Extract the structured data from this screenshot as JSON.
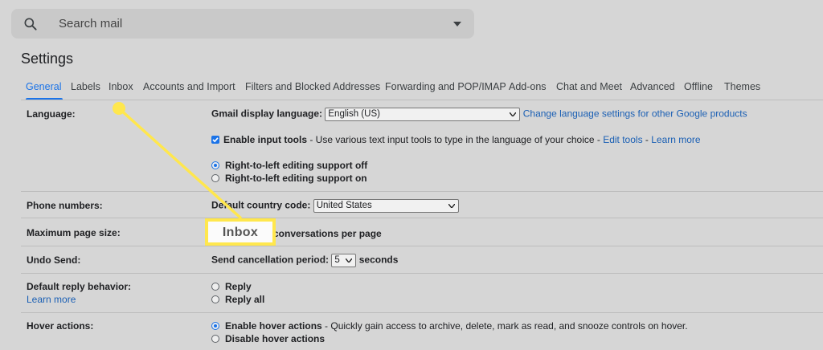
{
  "search": {
    "placeholder": "Search mail",
    "icon": "search-icon"
  },
  "settings": {
    "title": "Settings"
  },
  "tabs": [
    {
      "label": "General",
      "active": true
    },
    {
      "label": "Labels"
    },
    {
      "label": "Inbox"
    },
    {
      "label": "Accounts and Import"
    },
    {
      "label": "Filters and Blocked Addresses"
    },
    {
      "label": "Forwarding and POP/IMAP"
    },
    {
      "label": "Add-ons"
    },
    {
      "label": "Chat and Meet"
    },
    {
      "label": "Advanced"
    },
    {
      "label": "Offline"
    },
    {
      "label": "Themes"
    }
  ],
  "language": {
    "label": "Language:",
    "display_label": "Gmail display language:",
    "display_value": "English (US)",
    "change_link": "Change language settings for other Google products",
    "input_tools_label": "Enable input tools",
    "input_tools_desc": " - Use various text input tools to type in the language of your choice - ",
    "edit_tools": "Edit tools",
    "sep": " - ",
    "learn_more": "Learn more",
    "rtl_off": "Right-to-left editing support off",
    "rtl_on": "Right-to-left editing support on"
  },
  "phone": {
    "label": "Phone numbers:",
    "country_label": "Default country code:",
    "country_value": "United States"
  },
  "page_size": {
    "label": "Maximum page size:",
    "suffix": "conversations per page"
  },
  "undo": {
    "label": "Undo Send:",
    "period_label": "Send cancellation period:",
    "period_value": "5",
    "unit": "seconds"
  },
  "reply": {
    "label": "Default reply behavior:",
    "learn_more": "Learn more",
    "opt_reply": "Reply",
    "opt_reply_all": "Reply all"
  },
  "hover": {
    "label": "Hover actions:",
    "enable": "Enable hover actions",
    "enable_desc": " - Quickly gain access to archive, delete, mark as read, and snooze controls on hover.",
    "disable": "Disable hover actions"
  },
  "callout": {
    "text": "Inbox",
    "color": "#ffe74d"
  },
  "colors": {
    "accent": "#1a73e8",
    "link": "#1a5fb4"
  }
}
